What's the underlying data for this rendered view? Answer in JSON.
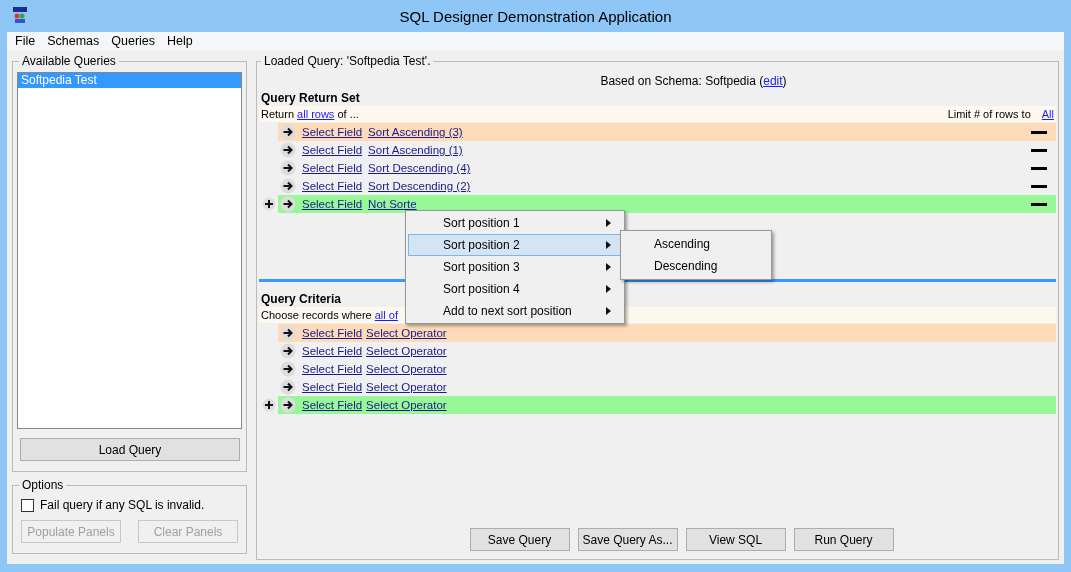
{
  "window": {
    "title": "SQL Designer Demonstration Application"
  },
  "menu": [
    "File",
    "Schemas",
    "Queries",
    "Help"
  ],
  "available_queries": {
    "title": "Available Queries",
    "items": [
      {
        "label": "Softpedia Test",
        "selected": true
      }
    ],
    "load_button": "Load Query"
  },
  "options": {
    "title": "Options",
    "checkbox": {
      "label": "Fail query if any SQL is invalid.",
      "checked": false
    },
    "buttons": [
      {
        "label": "Populate Panels",
        "disabled": true
      },
      {
        "label": "Clear Panels",
        "disabled": true
      }
    ]
  },
  "loaded_query": {
    "title": "Loaded Query: 'Softpedia Test'.",
    "schema_prefix": "Based on Schema: Softpedia (",
    "schema_link": "edit",
    "schema_suffix": ")",
    "return_set": {
      "heading": "Query Return Set",
      "intro_prefix": "Return ",
      "intro_link": "all rows",
      "intro_suffix": " of ...",
      "limit_label": "Limit # of rows to",
      "limit_link": "All",
      "rows": [
        {
          "kind": "hovered",
          "field": "Select Field",
          "action": "Sort Ascending (3)"
        },
        {
          "kind": "normal",
          "field": "Select Field",
          "action": "Sort Ascending (1)"
        },
        {
          "kind": "normal",
          "field": "Select Field",
          "action": "Sort Descending (4)"
        },
        {
          "kind": "normal",
          "field": "Select Field",
          "action": "Sort Descending (2)"
        },
        {
          "kind": "new",
          "field": "Select Field",
          "action": "Not Sorte"
        }
      ]
    },
    "criteria": {
      "heading": "Query Criteria",
      "intro_prefix": "Choose records where ",
      "intro_link": "all of",
      "rows": [
        {
          "kind": "hovered",
          "field": "Select Field",
          "action": "Select Operator"
        },
        {
          "kind": "normal",
          "field": "Select Field",
          "action": "Select Operator"
        },
        {
          "kind": "normal",
          "field": "Select Field",
          "action": "Select Operator"
        },
        {
          "kind": "normal",
          "field": "Select Field",
          "action": "Select Operator"
        },
        {
          "kind": "new",
          "field": "Select Field",
          "action": "Select Operator"
        }
      ]
    },
    "buttons": [
      "Save Query",
      "Save Query As...",
      "View SQL",
      "Run Query"
    ]
  },
  "context_menu": {
    "items": [
      {
        "label": "Sort position 1",
        "selected": false
      },
      {
        "label": "Sort position 2",
        "selected": true
      },
      {
        "label": "Sort position 3",
        "selected": false
      },
      {
        "label": "Sort position 4",
        "selected": false
      },
      {
        "label": "Add to next sort position",
        "selected": false
      }
    ],
    "submenu": [
      "Ascending",
      "Descending"
    ]
  }
}
